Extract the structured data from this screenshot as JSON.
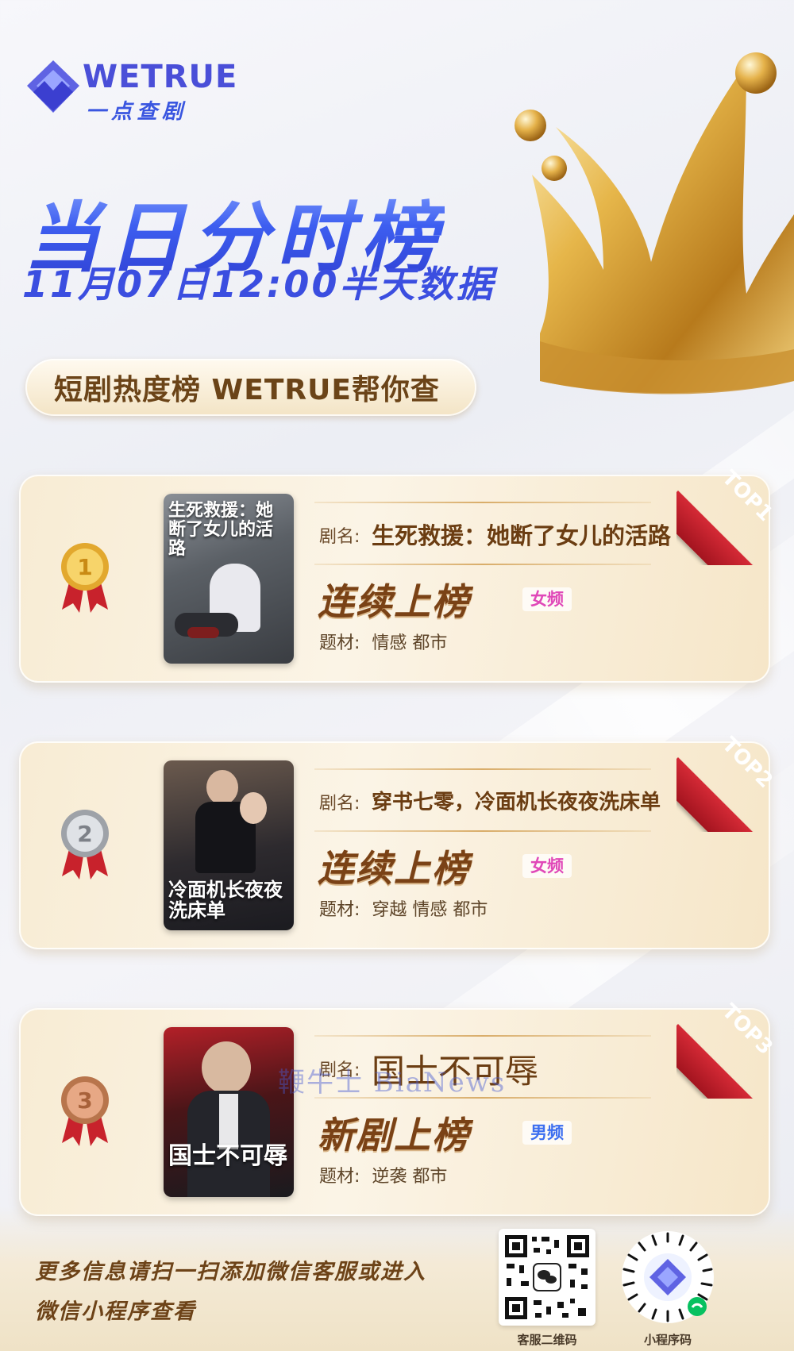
{
  "brand": {
    "name": "WETRUE",
    "subtitle": "一点查剧"
  },
  "header": {
    "title": "当日分时榜",
    "subtitle": "11月07日12:00半天数据",
    "slogan": "短剧热度榜 WETRUE帮你查"
  },
  "rankings": [
    {
      "rank_badge": "TOP1",
      "medal": "gold-medal",
      "name_label": "剧名:",
      "name": "生死救援：她断了女儿的活路",
      "status": "连续上榜",
      "channel": "女频",
      "genre_label": "题材:",
      "genre": "情感 都市",
      "poster_text": "生死救援：她断了女儿的活路"
    },
    {
      "rank_badge": "TOP2",
      "medal": "silver-medal",
      "name_label": "剧名:",
      "name": "穿书七零，冷面机长夜夜洗床单",
      "status": "连续上榜",
      "channel": "女频",
      "genre_label": "题材:",
      "genre": "穿越 情感 都市",
      "poster_text": "冷面机长夜夜洗床单"
    },
    {
      "rank_badge": "TOP3",
      "medal": "bronze-medal",
      "name_label": "剧名:",
      "name": "国士不可辱",
      "status": "新剧上榜",
      "channel": "男频",
      "genre_label": "题材:",
      "genre": "逆袭 都市",
      "poster_text": "国士不可辱"
    }
  ],
  "watermark": "鞭牛士 BiaNews",
  "footer": {
    "line1": "更多信息请扫一扫添加微信客服或进入",
    "line2": "微信小程序查看",
    "qr_service_caption": "客服二维码",
    "qr_miniprogram_caption": "小程序码"
  },
  "colors": {
    "accent_blue": "#3d57e6",
    "gold": "#d9ad6a",
    "ribbon_red": "#c21f2b",
    "female_tag": "#e048b8",
    "male_tag": "#3d6ff0"
  }
}
